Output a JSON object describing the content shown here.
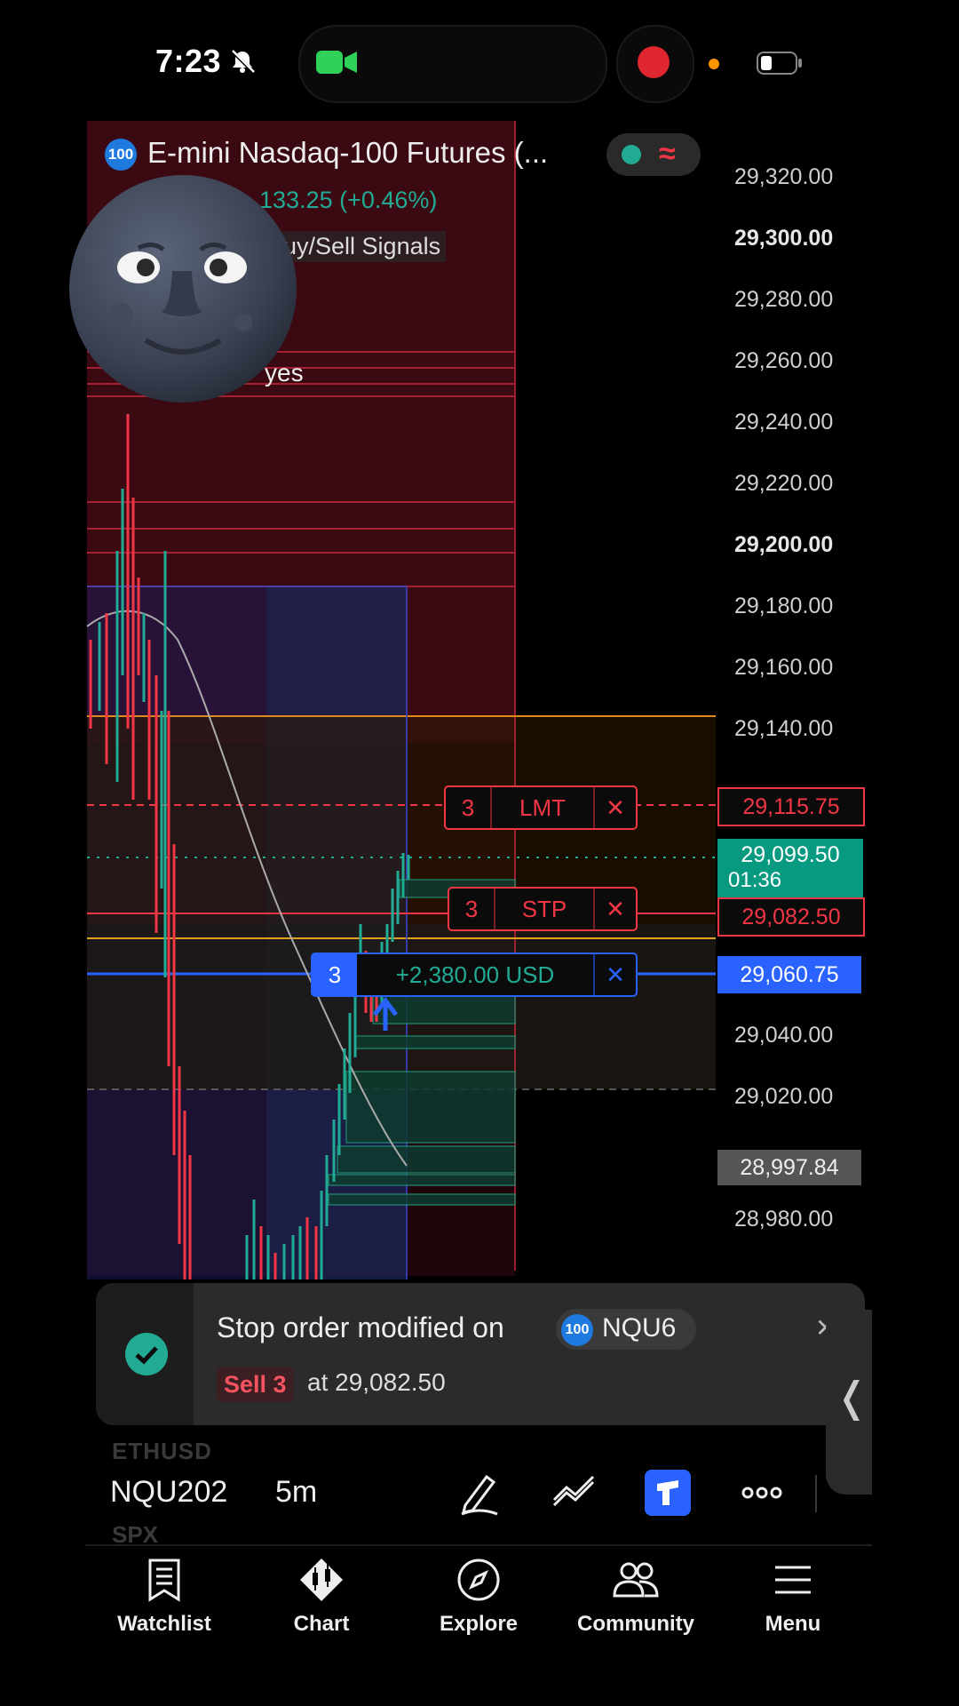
{
  "status_bar": {
    "time": "7:23",
    "icons": [
      "bell-slash-icon",
      "video-camera-icon",
      "record-icon",
      "battery-icon"
    ]
  },
  "header": {
    "badge": "100",
    "title": "E-mini Nasdaq-100 Futures (...",
    "change": "133.25 (+0.46%)",
    "indicator": "uy/Sell Signals",
    "indicator_value": "yes"
  },
  "price_axis": [
    {
      "label": "29,320.00",
      "bold": false
    },
    {
      "label": "29,300.00",
      "bold": true
    },
    {
      "label": "29,280.00",
      "bold": false
    },
    {
      "label": "29,260.00",
      "bold": false
    },
    {
      "label": "29,240.00",
      "bold": false
    },
    {
      "label": "29,220.00",
      "bold": false
    },
    {
      "label": "29,200.00",
      "bold": true
    },
    {
      "label": "29,180.00",
      "bold": false
    },
    {
      "label": "29,160.00",
      "bold": false
    },
    {
      "label": "29,140.00",
      "bold": false
    },
    {
      "label": "29,040.00",
      "bold": false
    },
    {
      "label": "29,020.00",
      "bold": false
    },
    {
      "label": "28,980.00",
      "bold": false
    }
  ],
  "orders": {
    "limit": {
      "qty": "3",
      "type": "LMT",
      "price": "29,115.75"
    },
    "stop": {
      "qty": "3",
      "type": "STP",
      "price": "29,082.50"
    },
    "position": {
      "qty": "3",
      "pnl": "+2,380.00 USD",
      "price": "29,060.75"
    },
    "last_price": "29,099.50",
    "countdown": "01:36",
    "marker_price": "28,997.84",
    "colors": {
      "sell": "#f23645",
      "buy": "#2962ff",
      "last": "#089981",
      "up": "#22ab94"
    }
  },
  "toast": {
    "title": "Stop order modified on",
    "symbol_badge": "100",
    "symbol": "NQU6",
    "action": "Sell 3",
    "detail": "at 29,082.50"
  },
  "toolbar": {
    "ghost_top": "ETHUSD",
    "ghost_bottom": "SPX",
    "symbol": "NQU202",
    "interval": "5m",
    "icons": [
      "pen-icon",
      "drawing-tools-icon",
      "trade-icon",
      "more-icon"
    ]
  },
  "tabs": [
    {
      "label": "Watchlist",
      "icon": "watchlist-icon"
    },
    {
      "label": "Chart",
      "icon": "chart-icon"
    },
    {
      "label": "Explore",
      "icon": "compass-icon"
    },
    {
      "label": "Community",
      "icon": "community-icon"
    },
    {
      "label": "Menu",
      "icon": "menu-icon"
    }
  ]
}
